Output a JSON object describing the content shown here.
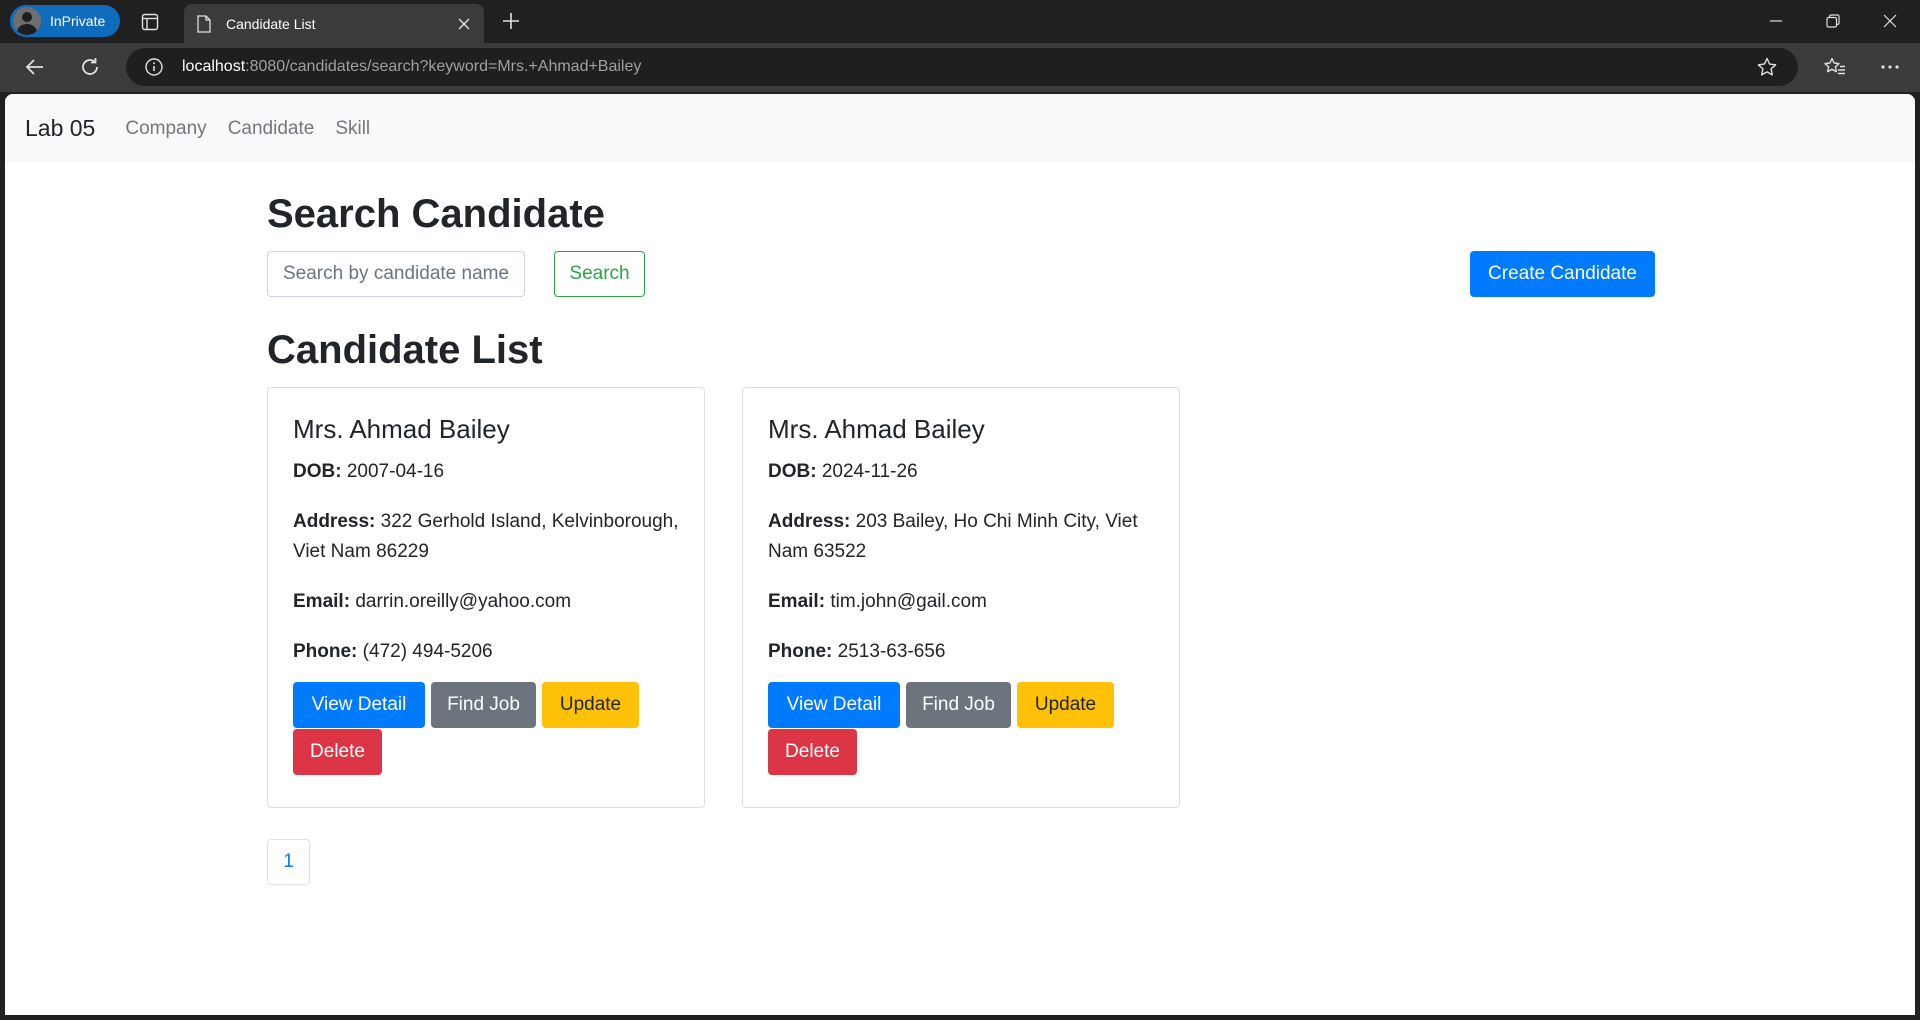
{
  "browser": {
    "profile_label": "InPrivate",
    "tab_title": "Candidate List",
    "url_host": "localhost",
    "url_rest": ":8080/candidates/search?keyword=Mrs.+Ahmad+Bailey"
  },
  "navbar": {
    "brand": "Lab 05",
    "links": [
      "Company",
      "Candidate",
      "Skill"
    ]
  },
  "search": {
    "heading": "Search Candidate",
    "placeholder": "Search by candidate name",
    "search_label": "Search",
    "create_label": "Create Candidate"
  },
  "list": {
    "heading": "Candidate List",
    "labels": {
      "dob": "DOB:",
      "address": "Address:",
      "email": "Email:",
      "phone": "Phone:"
    },
    "buttons": {
      "view": "View Detail",
      "find": "Find Job",
      "update": "Update",
      "delete": "Delete"
    },
    "candidates": [
      {
        "name": "Mrs. Ahmad Bailey",
        "dob": "2007-04-16",
        "address": "322 Gerhold Island, Kelvinborough, Viet Nam 86229",
        "email": "darrin.oreilly@yahoo.com",
        "phone": "(472) 494-5206"
      },
      {
        "name": "Mrs. Ahmad Bailey",
        "dob": "2024-11-26",
        "address": "203 Bailey, Ho Chi Minh City, Viet Nam 63522",
        "email": "tim.john@gail.com",
        "phone": "2513-63-656"
      }
    ]
  },
  "pagination": {
    "current": "1"
  },
  "colors": {
    "primary": "#007bff",
    "success": "#28a745",
    "secondary": "#6c757d",
    "warning": "#ffc107",
    "danger": "#dc3545"
  }
}
